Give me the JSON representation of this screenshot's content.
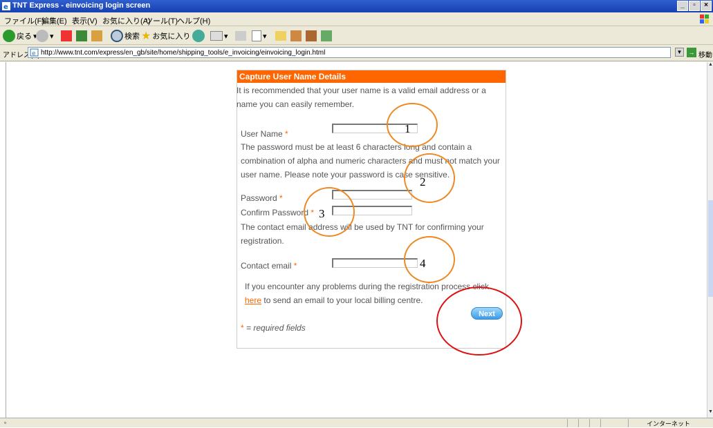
{
  "window": {
    "title": "TNT Express - einvoicing login screen"
  },
  "menu": {
    "items": [
      "ファイル(F)",
      "編集(E)",
      "表示(V)",
      "お気に入り(A)",
      "ツール(T)",
      "ヘルプ(H)"
    ]
  },
  "toolbar": {
    "back_label": "戻る",
    "search_label": "検索",
    "favorites_label": "お気に入り"
  },
  "address": {
    "label": "アドレス(D)",
    "url": "http://www.tnt.com/express/en_gb/site/home/shipping_tools/e_invoicing/einvoicing_login.html",
    "go_label": "移動"
  },
  "status": {
    "zone": "インターネット"
  },
  "form": {
    "heading": "Capture User Name Details",
    "intro": "It is recommended that your user name is a valid email address or a name you can easily remember.",
    "username_label": "User Name",
    "password_hint": "The password must be at least 6 characters long and contain a combination of alpha and numeric characters and must not match your user name. Please note your password is case sensitive.",
    "password_label": "Password",
    "confirm_label": "Confirm Password",
    "email_hint": "The contact email address will be used by TNT for confirming your registration.",
    "email_label": "Contact email",
    "help_pre": "If you encounter any problems during the registration process click",
    "help_link": "here",
    "help_post": " to send an email to your local billing centre.",
    "next_label": "Next",
    "required_star": "*",
    "required_note": " = required fields"
  },
  "annotations": {
    "n1": "1",
    "n2": "2",
    "n3": "3",
    "n4": "4"
  },
  "colors": {
    "accent": "#ff6600",
    "circle": "#ee8822",
    "circle_red": "#dd1111"
  }
}
